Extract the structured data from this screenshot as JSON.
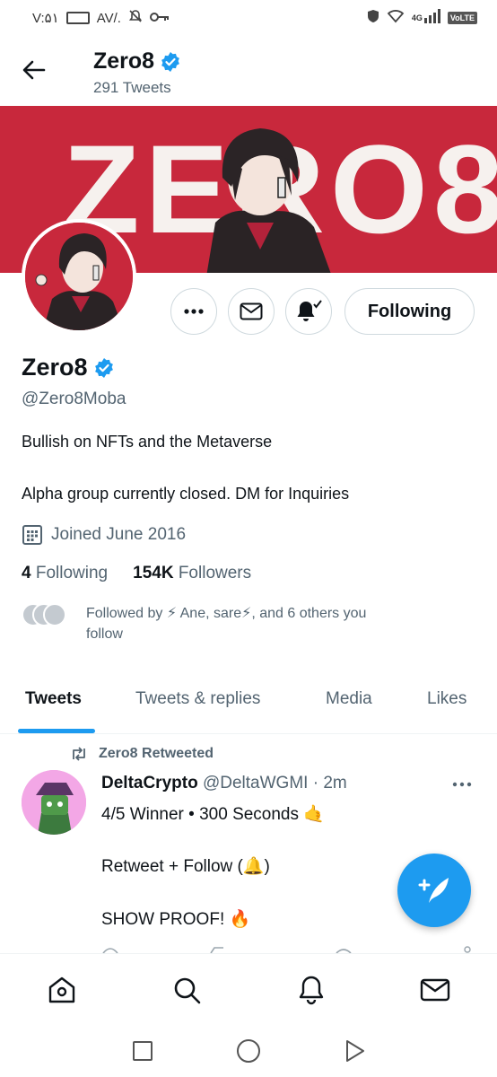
{
  "status_bar": {
    "time": "V:۵۱",
    "speed": "AV/.",
    "network": "4G",
    "volte": "VoLTE"
  },
  "header": {
    "name": "Zero8",
    "tweet_count": "291 Tweets"
  },
  "banner": {
    "text": "ZERO8"
  },
  "actions": {
    "follow_state": "Following"
  },
  "profile": {
    "name": "Zero8",
    "handle": "@Zero8Moba",
    "bio_line1": "Bullish on NFTs and the Metaverse",
    "bio_line2": "Alpha group currently closed. DM for Inquiries",
    "joined": "Joined June 2016",
    "following_count": "4",
    "following_label": "Following",
    "followers_count": "154K",
    "followers_label": "Followers",
    "followed_by_line1": "Followed by ⚡ Ane, sare⚡, and 6 others you",
    "followed_by_line2": "follow"
  },
  "tabs": [
    {
      "label": "Tweets",
      "active": true
    },
    {
      "label": "Tweets & replies",
      "active": false
    },
    {
      "label": "Media",
      "active": false
    },
    {
      "label": "Likes",
      "active": false
    }
  ],
  "tweet": {
    "retweeted_by": "Zero8 Retweeted",
    "author_name": "DeltaCrypto",
    "author_handle": "@DeltaWGMI",
    "time": "· 2m",
    "line1": "4/5 Winner • 300 Seconds 🤙",
    "line2": "Retweet + Follow (🔔)",
    "line3": "SHOW PROOF! 🔥"
  },
  "colors": {
    "accent": "#1d9bf0",
    "banner_red": "#c8283c",
    "secondary_text": "#536471"
  },
  "icons": {
    "back": "arrow-left-icon",
    "verified": "verified-badge-icon",
    "more": "more-horizontal-icon",
    "message": "envelope-icon",
    "notifications": "bell-check-icon",
    "calendar": "calendar-icon",
    "retweet": "retweet-icon",
    "compose": "feather-plus-icon",
    "home": "home-icon",
    "search": "search-icon",
    "bell": "bell-icon",
    "mail": "envelope-icon"
  }
}
